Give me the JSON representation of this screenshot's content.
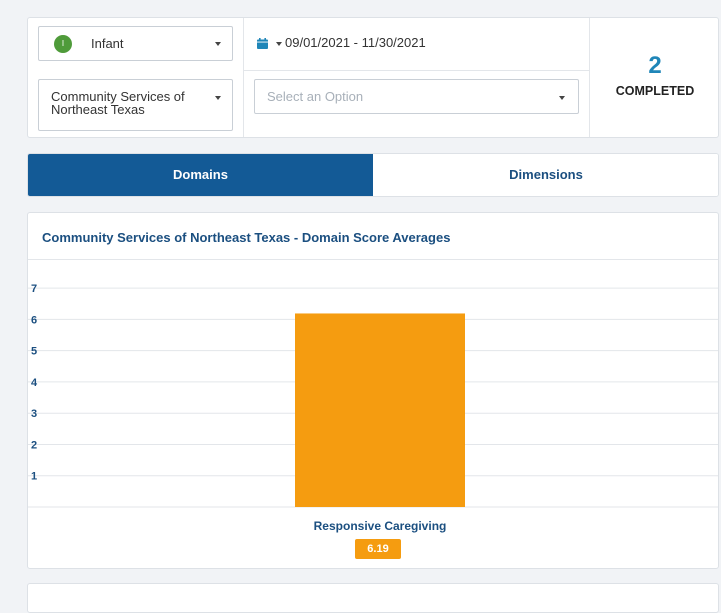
{
  "filters": {
    "age_group": {
      "avatar_letter": "I",
      "label": "Infant"
    },
    "date_range": {
      "text": "09/01/2021  -  11/30/2021"
    },
    "program": {
      "label": "Community Services of Northeast Texas"
    },
    "option": {
      "placeholder": "Select an Option"
    },
    "completed": {
      "count": "2",
      "label": "COMPLETED"
    }
  },
  "tabs": [
    {
      "label": "Domains",
      "active": true
    },
    {
      "label": "Dimensions",
      "active": false
    }
  ],
  "colors": {
    "primary": "#135a96",
    "accent_text": "#1b4f80",
    "bar": "#f59c10",
    "avatar": "#4f9b3a",
    "count": "#1f86b8"
  },
  "chart_data": {
    "type": "bar",
    "title": "Community Services of Northeast Texas - Domain Score Averages",
    "categories": [
      "Responsive Caregiving"
    ],
    "values": [
      6.19
    ],
    "value_labels": [
      "6.19"
    ],
    "yticks": [
      1,
      2,
      3,
      4,
      5,
      6,
      7
    ],
    "ylim": [
      0,
      7.9
    ],
    "grid": true,
    "bar_color": "#f59c10"
  }
}
